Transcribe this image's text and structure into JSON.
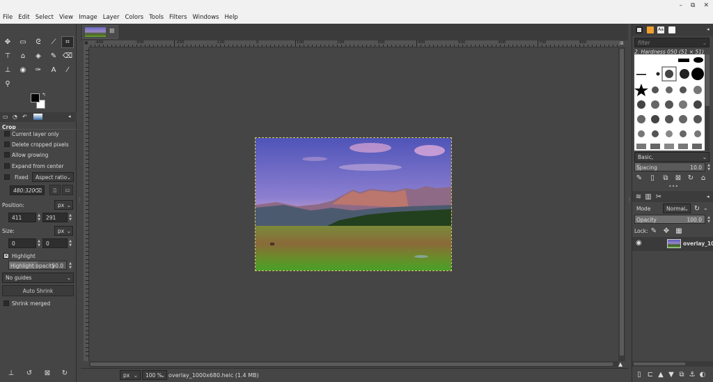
{
  "menu": [
    "File",
    "Edit",
    "Select",
    "View",
    "Image",
    "Layer",
    "Colors",
    "Tools",
    "Filters",
    "Windows",
    "Help"
  ],
  "window_controls": {
    "minimize": "–",
    "maximize": "⧉",
    "close": "✕"
  },
  "tool_options": {
    "title": "Crop",
    "current_layer_only": "Current layer only",
    "delete_cropped": "Delete cropped pixels",
    "allow_growing": "Allow growing",
    "expand_from_center": "Expand from center",
    "fixed_label": "Fixed",
    "fixed_mode": "Aspect ratio",
    "ratio_value": "480:320",
    "position_label": "Position:",
    "position_unit": "px",
    "pos_x": "411",
    "pos_y": "291",
    "size_label": "Size:",
    "size_unit": "px",
    "size_w": "0",
    "size_h": "0",
    "highlight_label": "Highlight",
    "highlight_opacity_label": "Highlight opacity",
    "highlight_opacity_value": "50.0",
    "guides_value": "No guides",
    "auto_shrink": "Auto Shrink",
    "shrink_merged": "Shrink merged"
  },
  "ruler_labels": [
    "-400",
    "-300",
    "-200",
    "-100",
    "0",
    "100",
    "200",
    "300",
    "400",
    "500",
    "600",
    "700",
    "800"
  ],
  "status": {
    "unit": "px",
    "zoom": "100 %",
    "file_info": "overlay_1000x680.heic (1.4 MB)"
  },
  "brushes": {
    "filter_placeholder": "filter",
    "current_brush": "2. Hardness 050 (51 × 51)",
    "preset": "Basic,",
    "spacing_label": "Spacing",
    "spacing_value": "10.0"
  },
  "layers": {
    "mode_label": "Mode",
    "mode_value": "Normal",
    "opacity_label": "Opacity",
    "opacity_value": "100.0",
    "lock_label": "Lock:",
    "layer_name": "overlay_10"
  },
  "colors": {
    "fg": "#000000",
    "bg": "#ffffff",
    "dock_bg": "#454545",
    "canvas_bg": "#454545"
  }
}
